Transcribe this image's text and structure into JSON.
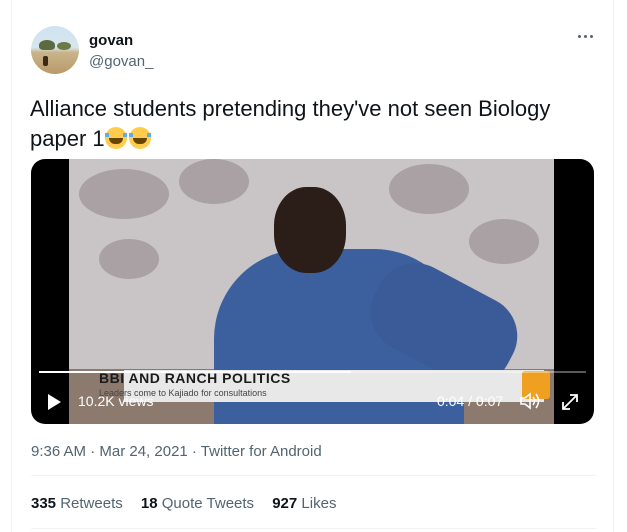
{
  "author": {
    "name": "govan",
    "handle": "@govan_"
  },
  "tweet": {
    "text": "Alliance students pretending they've not seen  Biology paper 1"
  },
  "video": {
    "lower_third_title": "BBI AND RANCH POLITICS",
    "lower_third_sub": "Leaders come to Kajiado for consultations",
    "views": "10.2K views",
    "time": "0:04 / 0:07",
    "progress_fraction": 0.57
  },
  "meta": {
    "timestamp": "9:36 AM · Mar 24, 2021 · Twitter for Android"
  },
  "stats": {
    "retweets_count": "335",
    "retweets_label": "Retweets",
    "quotes_count": "18",
    "quotes_label": "Quote Tweets",
    "likes_count": "927",
    "likes_label": "Likes"
  },
  "colors": {
    "muted": "#536471",
    "text": "#0f1419",
    "divider": "#eff3f4"
  },
  "icons": [
    "more-icon",
    "play-icon",
    "volume-icon",
    "fullscreen-icon",
    "crying-laughing-emoji"
  ]
}
